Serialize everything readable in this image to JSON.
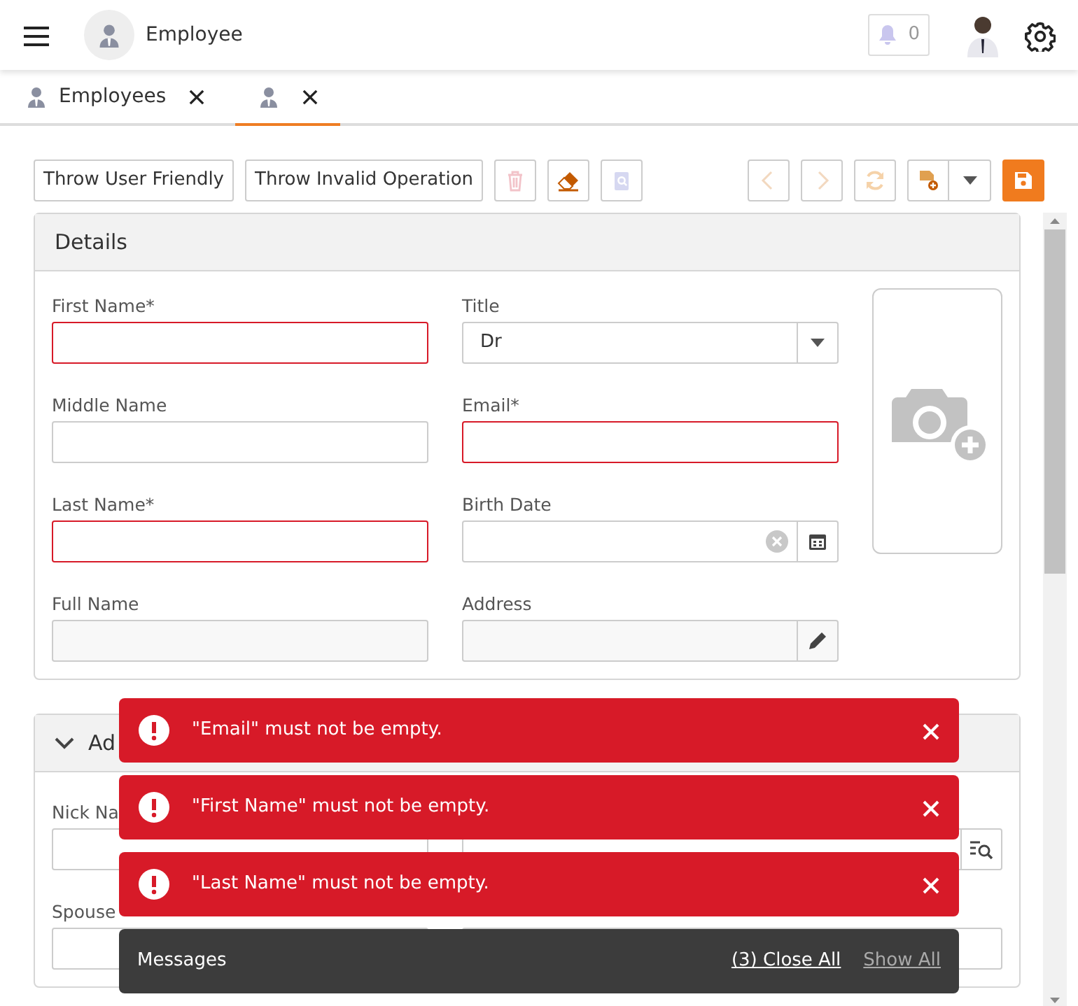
{
  "header": {
    "title": "Employee",
    "notification_count": "0"
  },
  "tabs": [
    {
      "label": "Employees",
      "selected": false
    },
    {
      "selected": true
    }
  ],
  "toolbar": {
    "buttons": [
      "Throw User Friendly",
      "Throw Invalid Operation"
    ],
    "icon_buttons": [
      {
        "kind": "delete",
        "disabled": true
      },
      {
        "kind": "clear",
        "disabled": false
      },
      {
        "kind": "inspect",
        "disabled": true
      }
    ],
    "nav_buttons": [
      {
        "kind": "previous",
        "disabled": true
      },
      {
        "kind": "next",
        "disabled": true
      },
      {
        "kind": "refresh",
        "disabled": true
      }
    ]
  },
  "panels": [
    {
      "title": "Details",
      "collapsible": false,
      "photo": true,
      "fields": [
        {
          "label": "First Name*",
          "kind": "text",
          "invalid": true
        },
        {
          "label": "Title",
          "kind": "select",
          "value": "Dr",
          "invalid": false
        },
        {
          "label": "Middle Name",
          "kind": "text",
          "invalid": false
        },
        {
          "label": "Email*",
          "kind": "text",
          "invalid": true
        },
        {
          "label": "Last Name*",
          "kind": "text",
          "invalid": true
        },
        {
          "label": "Birth Date",
          "kind": "date",
          "invalid": false
        },
        {
          "label": "Full Name",
          "kind": "readonly",
          "invalid": false
        },
        {
          "label": "Address",
          "kind": "editor",
          "invalid": false
        }
      ]
    },
    {
      "title": "Ad",
      "collapsible": true,
      "expanded": true,
      "photo": false,
      "fields": [
        {
          "label": "Nick Na",
          "kind": "text",
          "invalid": false
        },
        {
          "kind": "lookup",
          "invalid": false
        },
        {
          "label": "Spouse",
          "kind": "text",
          "invalid": false
        },
        {
          "kind": "text",
          "invalid": false
        }
      ]
    }
  ],
  "toasts": [
    {
      "message": "\"Email\" must not be empty."
    },
    {
      "message": "\"First Name\" must not be empty."
    },
    {
      "message": "\"Last Name\" must not be empty."
    }
  ],
  "messages_bar": {
    "title": "Messages",
    "close_all": "(3) Close All",
    "show_all": "Show All"
  }
}
